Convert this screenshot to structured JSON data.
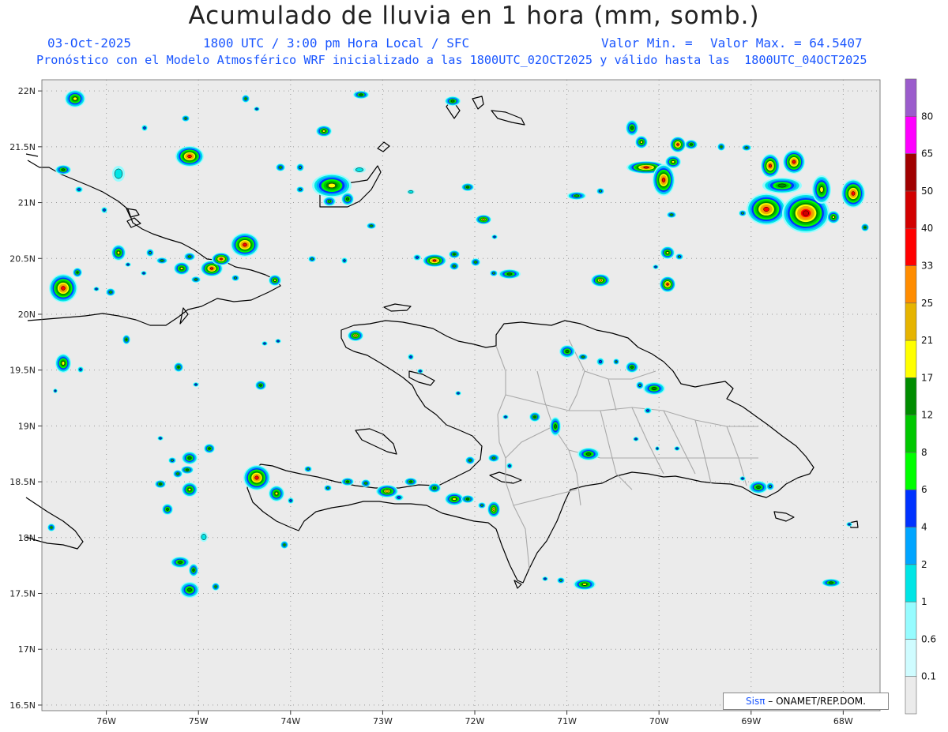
{
  "header": {
    "title": "Acumulado de lluvia en 1 hora (mm, somb.)",
    "date": "03-Oct-2025",
    "time": "1800 UTC / 3:00 pm Hora Local / SFC",
    "valmin_label": "Valor Min. =",
    "valmax_label": "Valor Max. = 64.5407",
    "model_line": "Pronóstico con el Modelo Atmosférico WRF inicializado a las 1800UTC_02OCT2025 y válido hasta las  1800UTC_04OCT2025"
  },
  "map": {
    "lon_range": [
      -76.7,
      -67.6
    ],
    "lat_range": [
      16.45,
      22.1
    ],
    "lat_labels": [
      "22N",
      "21.5N",
      "21N",
      "20.5N",
      "20N",
      "19.5N",
      "19N",
      "18.5N",
      "18N",
      "17.5N",
      "17N",
      "16.5N"
    ],
    "lon_labels": [
      "76W",
      "75W",
      "74W",
      "73W",
      "72W",
      "71W",
      "70W",
      "69W",
      "68W"
    ],
    "background": "#ebebeb",
    "coast_color": "#000000",
    "province_color": "#a0a0a0"
  },
  "colorbar": {
    "labels": [
      "80",
      "65",
      "50",
      "40",
      "33",
      "25",
      "21",
      "17",
      "12",
      "8",
      "6",
      "4",
      "2",
      "1",
      "0.6",
      "0.1"
    ],
    "colors": [
      "#ebebeb",
      "#cffcff",
      "#96fcff",
      "#00e5e5",
      "#00a5ff",
      "#0032ff",
      "#00ff00",
      "#00c800",
      "#008c00",
      "#ffff00",
      "#e6b400",
      "#ff8c00",
      "#ff0000",
      "#d20000",
      "#a00000",
      "#ff00ff",
      "#9b5ccc"
    ]
  },
  "credit": {
    "brand": "Sisπ",
    "rest": " – ONAMET/REP.DOM."
  }
}
